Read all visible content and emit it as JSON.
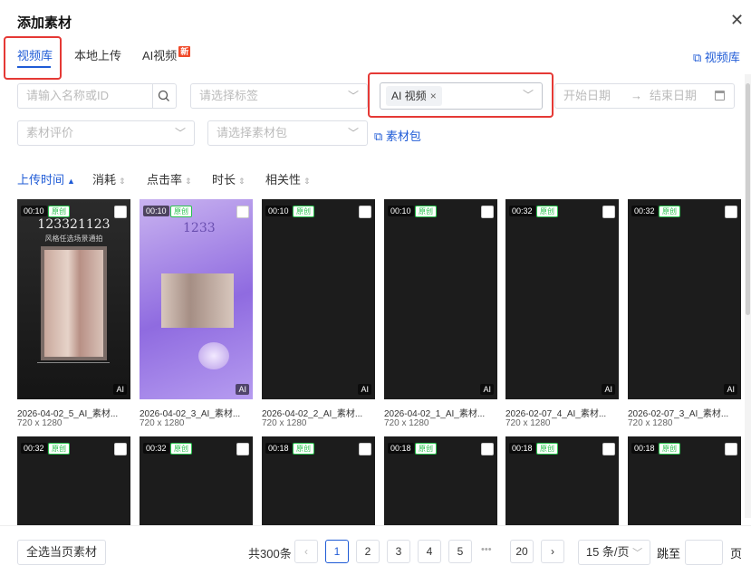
{
  "dialog": {
    "title": "添加素材"
  },
  "tabs": [
    {
      "label": "视频库"
    },
    {
      "label": "本地上传"
    },
    {
      "label": "AI视频",
      "badge": "新"
    }
  ],
  "header_link": "视频库",
  "filters": {
    "name_placeholder": "请输入名称或ID",
    "tag_placeholder": "请选择标签",
    "selected_tag": "AI 视频",
    "start_date": "开始日期",
    "end_date": "结束日期",
    "rating_placeholder": "素材评价",
    "package_placeholder": "请选择素材包",
    "package_link": "素材包"
  },
  "sort": [
    "上传时间",
    "消耗",
    "点击率",
    "时长",
    "相关性"
  ],
  "cards_row1": [
    {
      "duration": "00:10",
      "tag": "原创",
      "name": "2026-04-02_5_AI_素材...",
      "size": "720 x 1280",
      "ai": "AI",
      "overlay_title": "123321123",
      "overlay_sub": "风格任选场景通拍"
    },
    {
      "duration": "00:10",
      "tag": "原创",
      "name": "2026-04-02_3_AI_素材...",
      "size": "720 x 1280",
      "ai": "AI",
      "overlay_title": "1233"
    },
    {
      "duration": "00:10",
      "tag": "原创",
      "name": "2026-04-02_2_AI_素材...",
      "size": "720 x 1280",
      "ai": "AI"
    },
    {
      "duration": "00:10",
      "tag": "原创",
      "name": "2026-04-02_1_AI_素材...",
      "size": "720 x 1280",
      "ai": "AI"
    },
    {
      "duration": "00:32",
      "tag": "原创",
      "name": "2026-02-07_4_AI_素材...",
      "size": "720 x 1280",
      "ai": "AI"
    },
    {
      "duration": "00:32",
      "tag": "原创",
      "name": "2026-02-07_3_AI_素材...",
      "size": "720 x 1280",
      "ai": "AI"
    }
  ],
  "cards_row2": [
    {
      "duration": "00:32",
      "tag": "原创"
    },
    {
      "duration": "00:32",
      "tag": "原创"
    },
    {
      "duration": "00:18",
      "tag": "原创"
    },
    {
      "duration": "00:18",
      "tag": "原创"
    },
    {
      "duration": "00:18",
      "tag": "原创"
    },
    {
      "duration": "00:18",
      "tag": "原创"
    }
  ],
  "footer": {
    "select_page": "全选当页素材",
    "total": "共300条",
    "pages": [
      "1",
      "2",
      "3",
      "4",
      "5",
      "20"
    ],
    "ellipsis": "•••",
    "page_size": "15 条/页",
    "goto": "跳至",
    "page_unit": "页"
  },
  "colors": {
    "accent": "#1f5bd6",
    "highlight": "#e53935",
    "original_tag": "#27c24c"
  }
}
